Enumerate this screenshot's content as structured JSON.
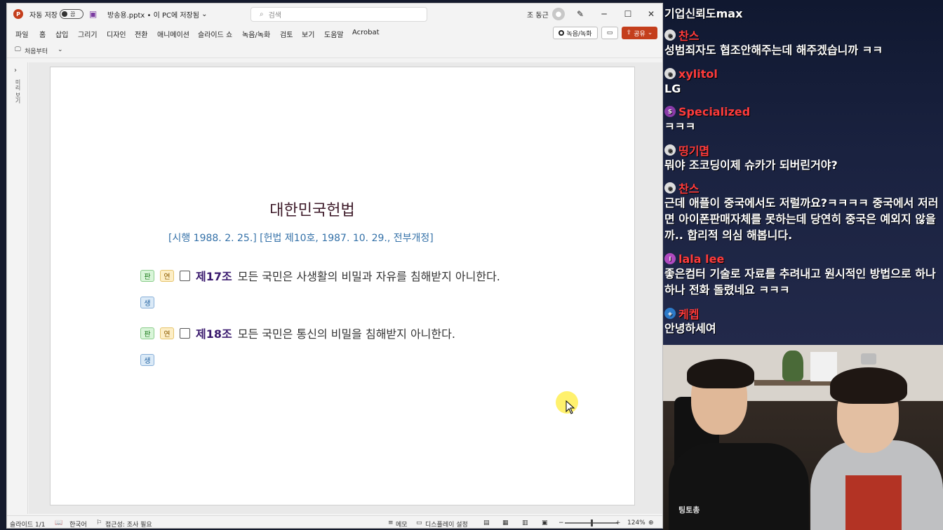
{
  "window": {
    "autosave_label": "자동 저장",
    "autosave_state": "끔",
    "file_title": "방송용.pptx • 이 PC에 저장됨",
    "search_placeholder": "검색",
    "user_name": "조 동근"
  },
  "menu": {
    "items": [
      "파일",
      "홈",
      "삽입",
      "그리기",
      "디자인",
      "전환",
      "애니메이션",
      "슬라이드 쇼",
      "녹음/녹화",
      "검토",
      "보기",
      "도움말",
      "Acrobat"
    ],
    "record_label": "녹음/녹화",
    "share_label": "공유"
  },
  "quickbar": {
    "from_start": "처음부터"
  },
  "sidepane": {
    "label": "미리 보기"
  },
  "slide": {
    "title": "대한민국헌법",
    "subtitle": "[시행 1988. 2. 25.] [헌법 제10호, 1987. 10. 29., 전부개정]",
    "tags": {
      "pan": "판",
      "yeon": "연",
      "saeng": "생"
    },
    "articles": [
      {
        "number": "제17조",
        "text": "모든 국민은 사생활의 비밀과 자유를 침해받지 아니한다."
      },
      {
        "number": "제18조",
        "text": "모든 국민은 통신의 비밀을 침해받지 아니한다."
      }
    ]
  },
  "status": {
    "slide_count": "슬라이드 1/1",
    "language": "한국어",
    "accessibility": "접근성: 조사 필요",
    "notes": "메모",
    "display_settings": "디스플레이 설정",
    "zoom": "124%"
  },
  "chat": {
    "messages": [
      {
        "user": "",
        "text": "기업신뢰도max",
        "color": "#ffffff"
      },
      {
        "user": "찬스",
        "text": "성범죄자도 협조안해주는데 해주겠습니까 ㅋㅋ",
        "color": "#ff3b3b",
        "badge": ""
      },
      {
        "user": "xylitol",
        "text": "LG",
        "color": "#ff3b3b",
        "badge": ""
      },
      {
        "user": "Specialized",
        "text": "ㅋㅋㅋ",
        "color": "#ff3b3b",
        "badge": "S"
      },
      {
        "user": "띵기몁",
        "text": "뭐야 조코딩이제 슈카가 되버린거야?",
        "color": "#ff3b3b",
        "badge": ""
      },
      {
        "user": "찬스",
        "text": "근데 애플이 중국에서도 저럴까요?ㅋㅋㅋㅋ 중국에서 저러면 아이폰판매자체를 못하는데 당연히 중국은 예외지 않을까.. 합리적 의심 해봅니다.",
        "color": "#ff3b3b",
        "badge": ""
      },
      {
        "user": "lala lee",
        "text": "좋은컴터 기술로 자료를 추려내고 원시적인 방법으로 하나하나 전화 돌렸네요 ㅋㅋㅋ",
        "color": "#ff3b3b",
        "badge": ""
      },
      {
        "user": "케켑",
        "text": "안녕하세여",
        "color": "#ff3b3b",
        "badge": ""
      }
    ]
  },
  "webcam": {
    "shirt_logo": "팅토총"
  }
}
